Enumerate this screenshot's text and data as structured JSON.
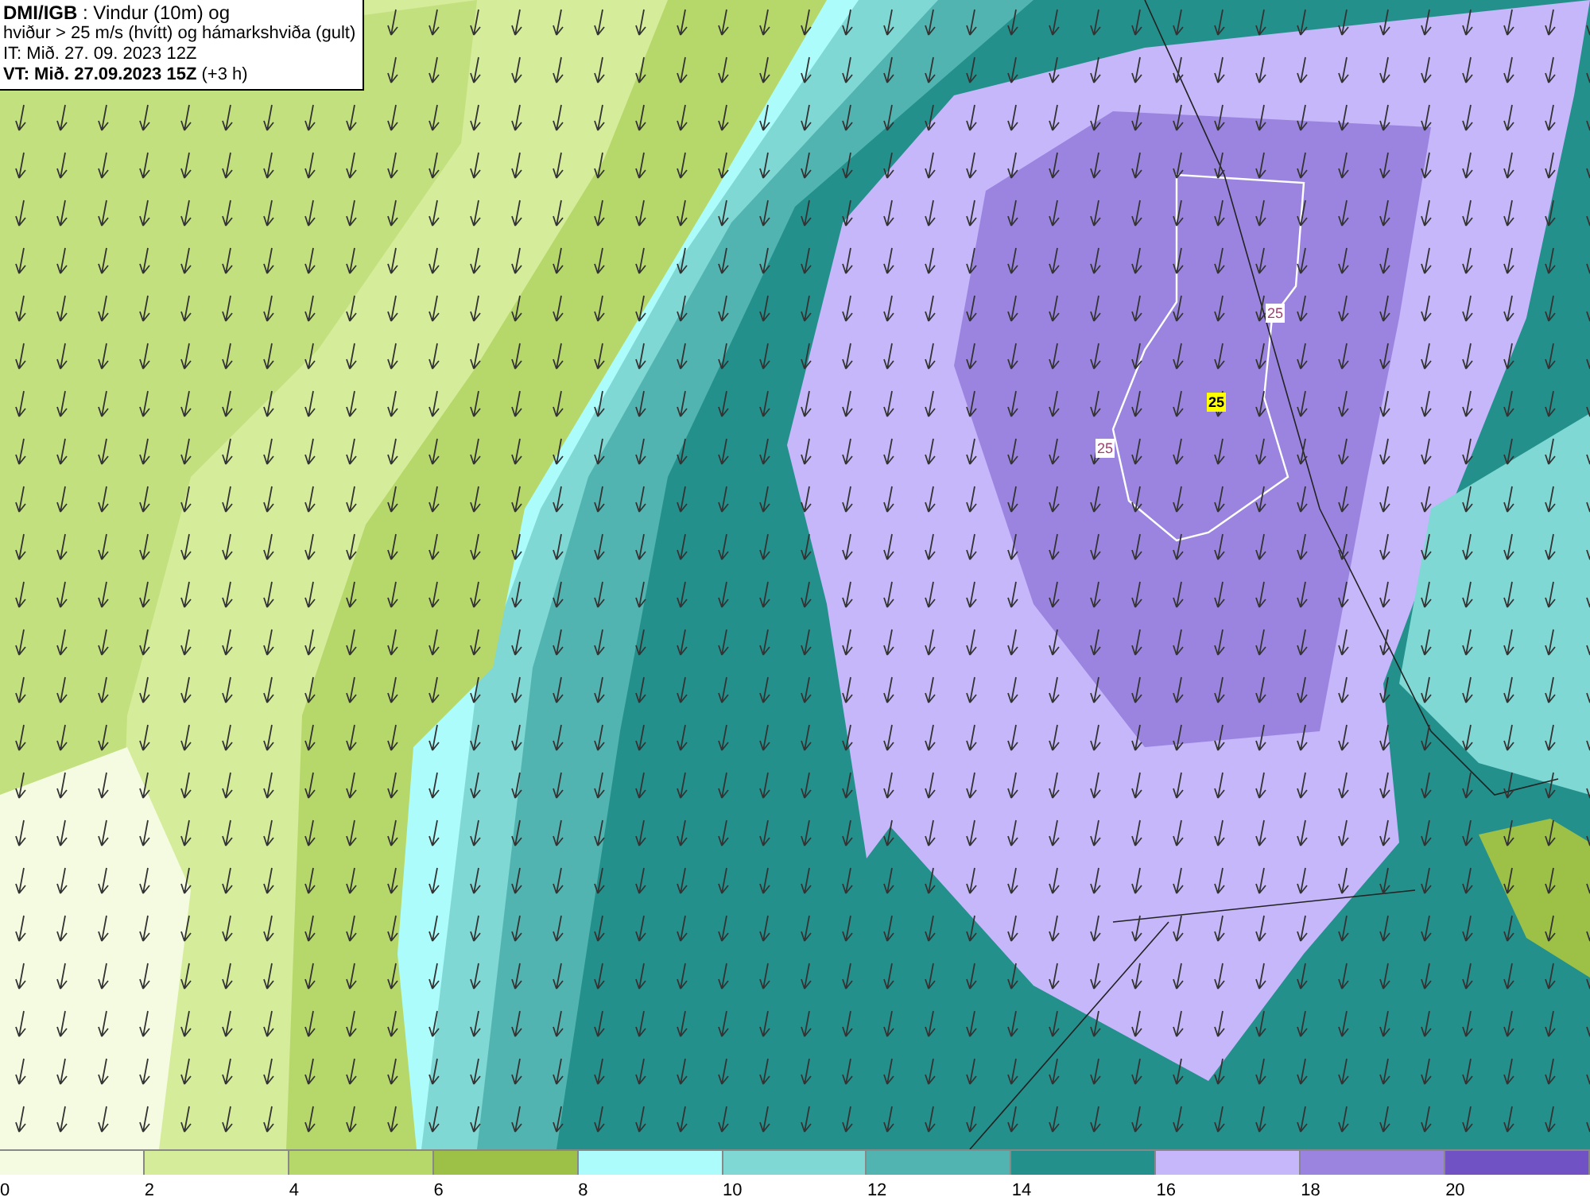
{
  "title_box": {
    "lines": [
      "**DMI/IGB** : Vindur (10m) og",
      "hviður > 25 m/s (hvítt) og hámarkshviða (gult)",
      "IT: Mið. 27. 09. 2023 12Z",
      "**VT: Mið. 27.09.2023 15Z** (+3 h)"
    ]
  },
  "map": {
    "labels": [
      {
        "text": "25",
        "kind": "gust"
      },
      {
        "text": "25",
        "kind": "max"
      },
      {
        "text": "25",
        "kind": "gust"
      }
    ]
  },
  "legend": {
    "bins": [
      {
        "label": "0",
        "color": "#f5fbe1"
      },
      {
        "label": "2",
        "color": "#d5ec9a"
      },
      {
        "label": "4",
        "color": "#b6d86a"
      },
      {
        "label": "6",
        "color": "#9cc146"
      },
      {
        "label": "8",
        "color": "#adfcfc"
      },
      {
        "label": "10",
        "color": "#7fd8d4"
      },
      {
        "label": "12",
        "color": "#52b4b0"
      },
      {
        "label": "14",
        "color": "#23908c"
      },
      {
        "label": "16",
        "color": "#c6b6fa"
      },
      {
        "label": "18",
        "color": "#9b84e0"
      },
      {
        "label": "20",
        "color": "#7052c4"
      }
    ]
  }
}
